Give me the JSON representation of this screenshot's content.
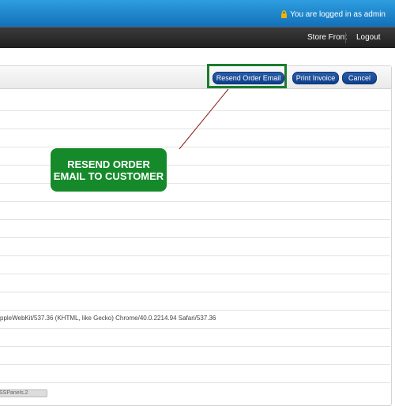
{
  "header": {
    "login_status": "You are logged in as admin",
    "colors": {
      "bar": "#1a7cc6",
      "lock": "#f0b400"
    }
  },
  "nav": {
    "links": [
      "Store Front",
      "Logout"
    ]
  },
  "toolbar": {
    "resend_label": "Resend Order Email",
    "print_label": "Print Invoice",
    "cancel_label": "Cancel",
    "button_color": "#0e3f8a"
  },
  "details": {
    "user_agent_fragment": "ppleWebKit/537.36 (KHTML, like Gecko) Chrome/40.0.2214.94 Safari/537.36",
    "bottom_tag_fragment": "SSPanels.2"
  },
  "annotation": {
    "callout_line1": "RESEND ORDER",
    "callout_line2": "EMAIL TO CUSTOMER",
    "callout_color": "#168a2b",
    "connector_color": "#8b1a1a"
  }
}
